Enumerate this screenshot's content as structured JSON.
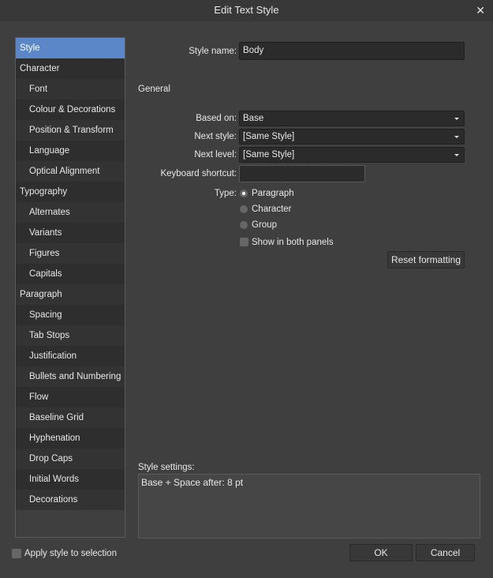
{
  "window": {
    "title": "Edit Text Style",
    "close_icon": "close-icon"
  },
  "sidebar": {
    "items": [
      {
        "label": "Style",
        "sub": false,
        "active": true
      },
      {
        "label": "Character",
        "sub": false
      },
      {
        "label": "Font",
        "sub": true
      },
      {
        "label": "Colour & Decorations",
        "sub": true
      },
      {
        "label": "Position & Transform",
        "sub": true
      },
      {
        "label": "Language",
        "sub": true
      },
      {
        "label": "Optical Alignment",
        "sub": true
      },
      {
        "label": "Typography",
        "sub": false
      },
      {
        "label": "Alternates",
        "sub": true
      },
      {
        "label": "Variants",
        "sub": true
      },
      {
        "label": "Figures",
        "sub": true
      },
      {
        "label": "Capitals",
        "sub": true
      },
      {
        "label": "Paragraph",
        "sub": false
      },
      {
        "label": "Spacing",
        "sub": true
      },
      {
        "label": "Tab Stops",
        "sub": true
      },
      {
        "label": "Justification",
        "sub": true
      },
      {
        "label": "Bullets and Numbering",
        "sub": true
      },
      {
        "label": "Flow",
        "sub": true
      },
      {
        "label": "Baseline Grid",
        "sub": true
      },
      {
        "label": "Hyphenation",
        "sub": true
      },
      {
        "label": "Drop Caps",
        "sub": true
      },
      {
        "label": "Initial Words",
        "sub": true
      },
      {
        "label": "Decorations",
        "sub": true
      }
    ]
  },
  "form": {
    "style_name_label": "Style name:",
    "style_name_value": "Body",
    "general_heading": "General",
    "based_on_label": "Based on:",
    "based_on_value": "Base",
    "next_style_label": "Next style:",
    "next_style_value": "[Same Style]",
    "next_level_label": "Next level:",
    "next_level_value": "[Same Style]",
    "shortcut_label": "Keyboard shortcut:",
    "shortcut_value": "",
    "type_label": "Type:",
    "type_options": [
      "Paragraph",
      "Character",
      "Group"
    ],
    "type_selected": "Paragraph",
    "show_both_label": "Show in both panels",
    "show_both_checked": false,
    "reset_label": "Reset formatting",
    "settings_label": "Style settings:",
    "settings_value": "Base + Space after: 8 pt"
  },
  "footer": {
    "apply_label": "Apply style to selection",
    "apply_checked": false,
    "ok_label": "OK",
    "cancel_label": "Cancel"
  },
  "colors": {
    "accent": "#5b87c8",
    "background": "#3f3f3f"
  }
}
